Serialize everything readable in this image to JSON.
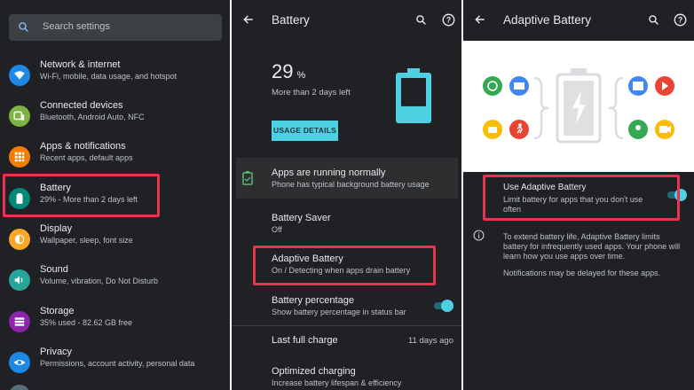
{
  "settings": {
    "search_placeholder": "Search settings",
    "items": [
      {
        "title": "Network & internet",
        "subtitle": "Wi-Fi, mobile, data usage, and hotspot",
        "icon": "wifi-icon",
        "color": "#1e88e5"
      },
      {
        "title": "Connected devices",
        "subtitle": "Bluetooth, Android Auto, NFC",
        "icon": "devices-icon",
        "color": "#7cb342"
      },
      {
        "title": "Apps & notifications",
        "subtitle": "Recent apps, default apps",
        "icon": "apps-icon",
        "color": "#f57c00"
      },
      {
        "title": "Battery",
        "subtitle": "29% - More than 2 days left",
        "icon": "battery-icon",
        "color": "#00897b"
      },
      {
        "title": "Display",
        "subtitle": "Wallpaper, sleep, font size",
        "icon": "brightness-icon",
        "color": "#f9a825"
      },
      {
        "title": "Sound",
        "subtitle": "Volume, vibration, Do Not Disturb",
        "icon": "volume-icon",
        "color": "#26a69a"
      },
      {
        "title": "Storage",
        "subtitle": "35% used - 82.62 GB free",
        "icon": "storage-icon",
        "color": "#8e24aa"
      },
      {
        "title": "Privacy",
        "subtitle": "Permissions, account activity, personal data",
        "icon": "eye-icon",
        "color": "#1e88e5"
      }
    ]
  },
  "battery": {
    "title": "Battery",
    "percent": "29",
    "percent_unit": "%",
    "time_left": "More than 2 days left",
    "usage_button": "USAGE DETAILS",
    "level": 0.29,
    "status_title": "Apps are running normally",
    "status_subtitle": "Phone has typical background battery usage",
    "rows": [
      {
        "title": "Battery Saver",
        "subtitle": "Off"
      },
      {
        "title": "Adaptive Battery",
        "subtitle": "On / Detecting when apps drain battery"
      },
      {
        "title": "Battery percentage",
        "subtitle": "Show battery percentage in status bar"
      }
    ],
    "last_charge_label": "Last full charge",
    "last_charge_value": "11 days ago",
    "optimized_title": "Optimized charging",
    "optimized_subtitle": "Increase battery lifespan & efficiency"
  },
  "adaptive": {
    "title": "Adaptive Battery",
    "toggle_title": "Use Adaptive Battery",
    "toggle_subtitle_1": "Limit battery for apps that you don't use",
    "toggle_subtitle_2": "often",
    "info_1": "To extend battery life, Adaptive Battery limits",
    "info_2": "battery for infrequently used apps. Your phone will",
    "info_3": "learn how you use apps over time.",
    "info_4": "Notifications may be delayed for these apps."
  },
  "colors": {
    "accent": "#4dd0e1",
    "highlight": "#e8334f",
    "background": "#202124"
  }
}
